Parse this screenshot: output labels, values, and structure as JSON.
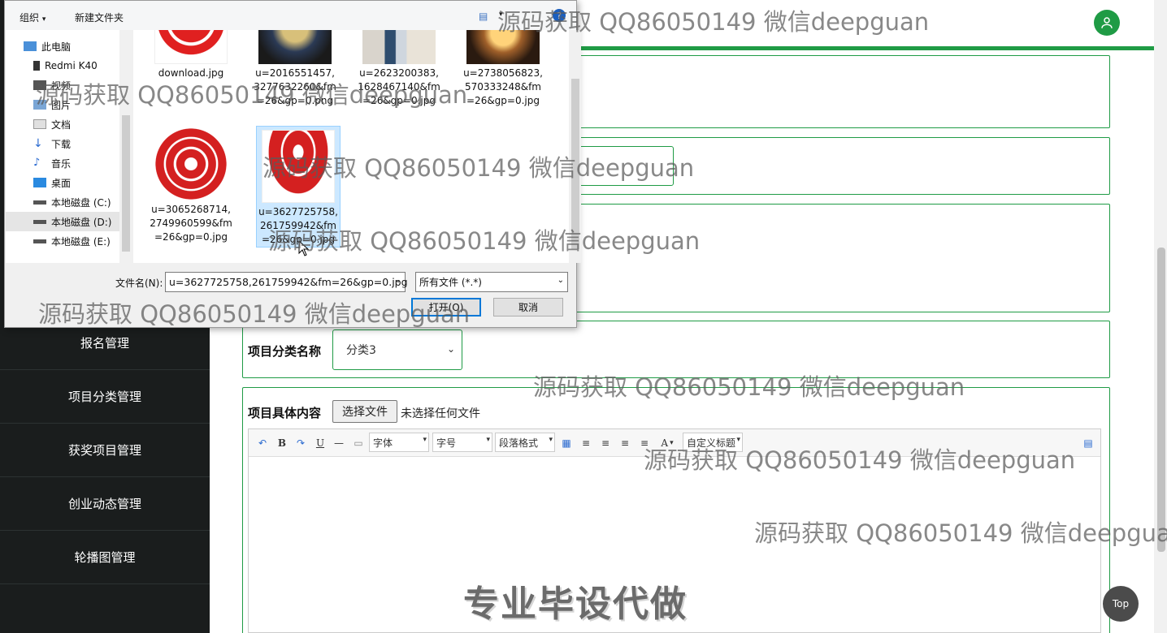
{
  "sidebar": {
    "items": [
      {
        "label": "报名管理"
      },
      {
        "label": "项目分类管理"
      },
      {
        "label": "获奖项目管理"
      },
      {
        "label": "创业动态管理"
      },
      {
        "label": "轮播图管理"
      }
    ]
  },
  "form": {
    "category_label": "项目分类名称",
    "category_value": "分类3",
    "content_label": "项目具体内容",
    "file_button": "选择文件",
    "file_status": "未选择任何文件"
  },
  "editor": {
    "font_placeholder": "字体",
    "size_placeholder": "字号",
    "paragraph_placeholder": "段落格式",
    "custom_title": "自定义标题",
    "bold": "B",
    "underline": "U",
    "font_color": "A"
  },
  "top_button": "Top",
  "promo_text": "专业毕设代做",
  "dialog": {
    "toolbar": {
      "organize": "组织",
      "new_folder": "新建文件夹"
    },
    "nav": [
      {
        "label": "此电脑",
        "icon": "pc-icon"
      },
      {
        "label": "Redmi K40",
        "icon": "phone-icon"
      },
      {
        "label": "视频",
        "icon": "video-icon"
      },
      {
        "label": "图片",
        "icon": "picture-icon"
      },
      {
        "label": "文档",
        "icon": "document-icon"
      },
      {
        "label": "下载",
        "icon": "download-icon"
      },
      {
        "label": "音乐",
        "icon": "music-icon"
      },
      {
        "label": "桌面",
        "icon": "desktop-icon"
      },
      {
        "label": "本地磁盘 (C:)",
        "icon": "drive-icon"
      },
      {
        "label": "本地磁盘 (D:)",
        "icon": "drive-icon"
      },
      {
        "label": "本地磁盘 (E:)",
        "icon": "drive-icon"
      }
    ],
    "files": [
      {
        "name": "download.jpg"
      },
      {
        "name": "u=2016551457,3277632260&fm=26&gp=0.png"
      },
      {
        "name": "u=2623200383,1628467140&fm=26&gp=0.jpg"
      },
      {
        "name": "u=2738056823,570333248&fm=26&gp=0.jpg"
      },
      {
        "name": "u=3065268714,2749960599&fm=26&gp=0.jpg"
      },
      {
        "name": "u=3627725758,261759942&fm=26&gp=0.jpg"
      }
    ],
    "filename_label": "文件名(N):",
    "filename_value": "u=3627725758,261759942&fm=26&gp=0.jpg",
    "filetype_value": "所有文件 (*.*)",
    "open_button": "打开(O)",
    "cancel_button": "取消"
  },
  "watermark": "源码获取 QQ86050149 微信deepguan",
  "colors": {
    "accent": "#1f9b45",
    "sidebar": "#1a1d1d",
    "selection": "#cce8ff"
  }
}
